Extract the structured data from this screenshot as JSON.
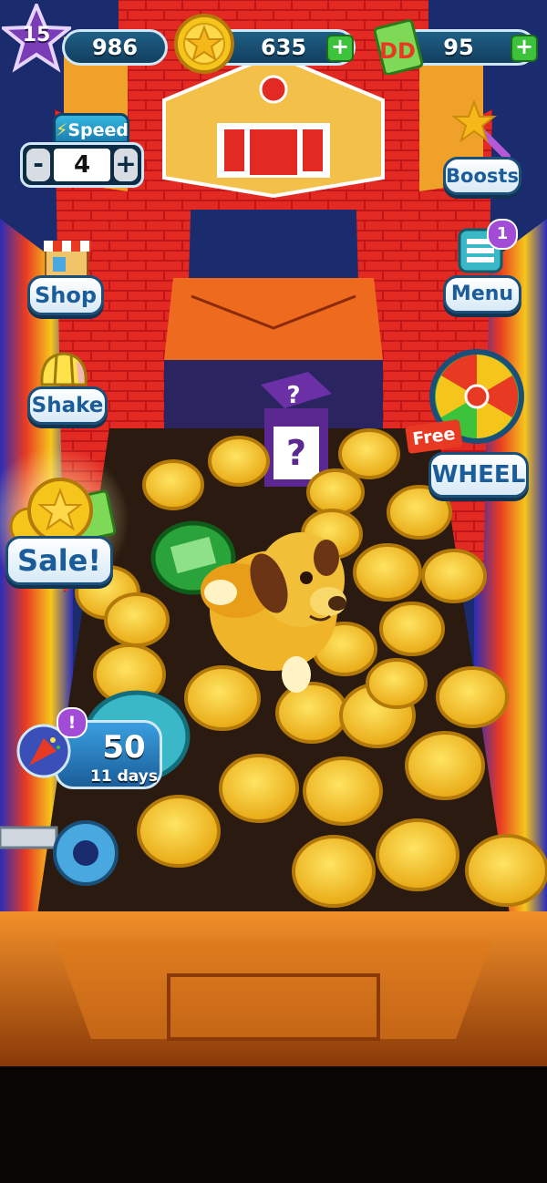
{
  "hud": {
    "level": "15",
    "xp": "986",
    "coins": "635",
    "cash": "95"
  },
  "speed": {
    "title": "Speed",
    "value": "4",
    "minus": "-",
    "plus": "+"
  },
  "buttons": {
    "boosts": "Boosts",
    "shop": "Shop",
    "menu": "Menu",
    "menu_badge": "1",
    "shake": "Shake",
    "sale": "Sale!",
    "wheel_free": "Free",
    "wheel": "WHEEL"
  },
  "event": {
    "badge": "!",
    "count": "50",
    "days": "11 days"
  },
  "colors": {
    "brick": "#c0161a",
    "coin": "#f6c51b",
    "accent": "#1a5d9a"
  }
}
